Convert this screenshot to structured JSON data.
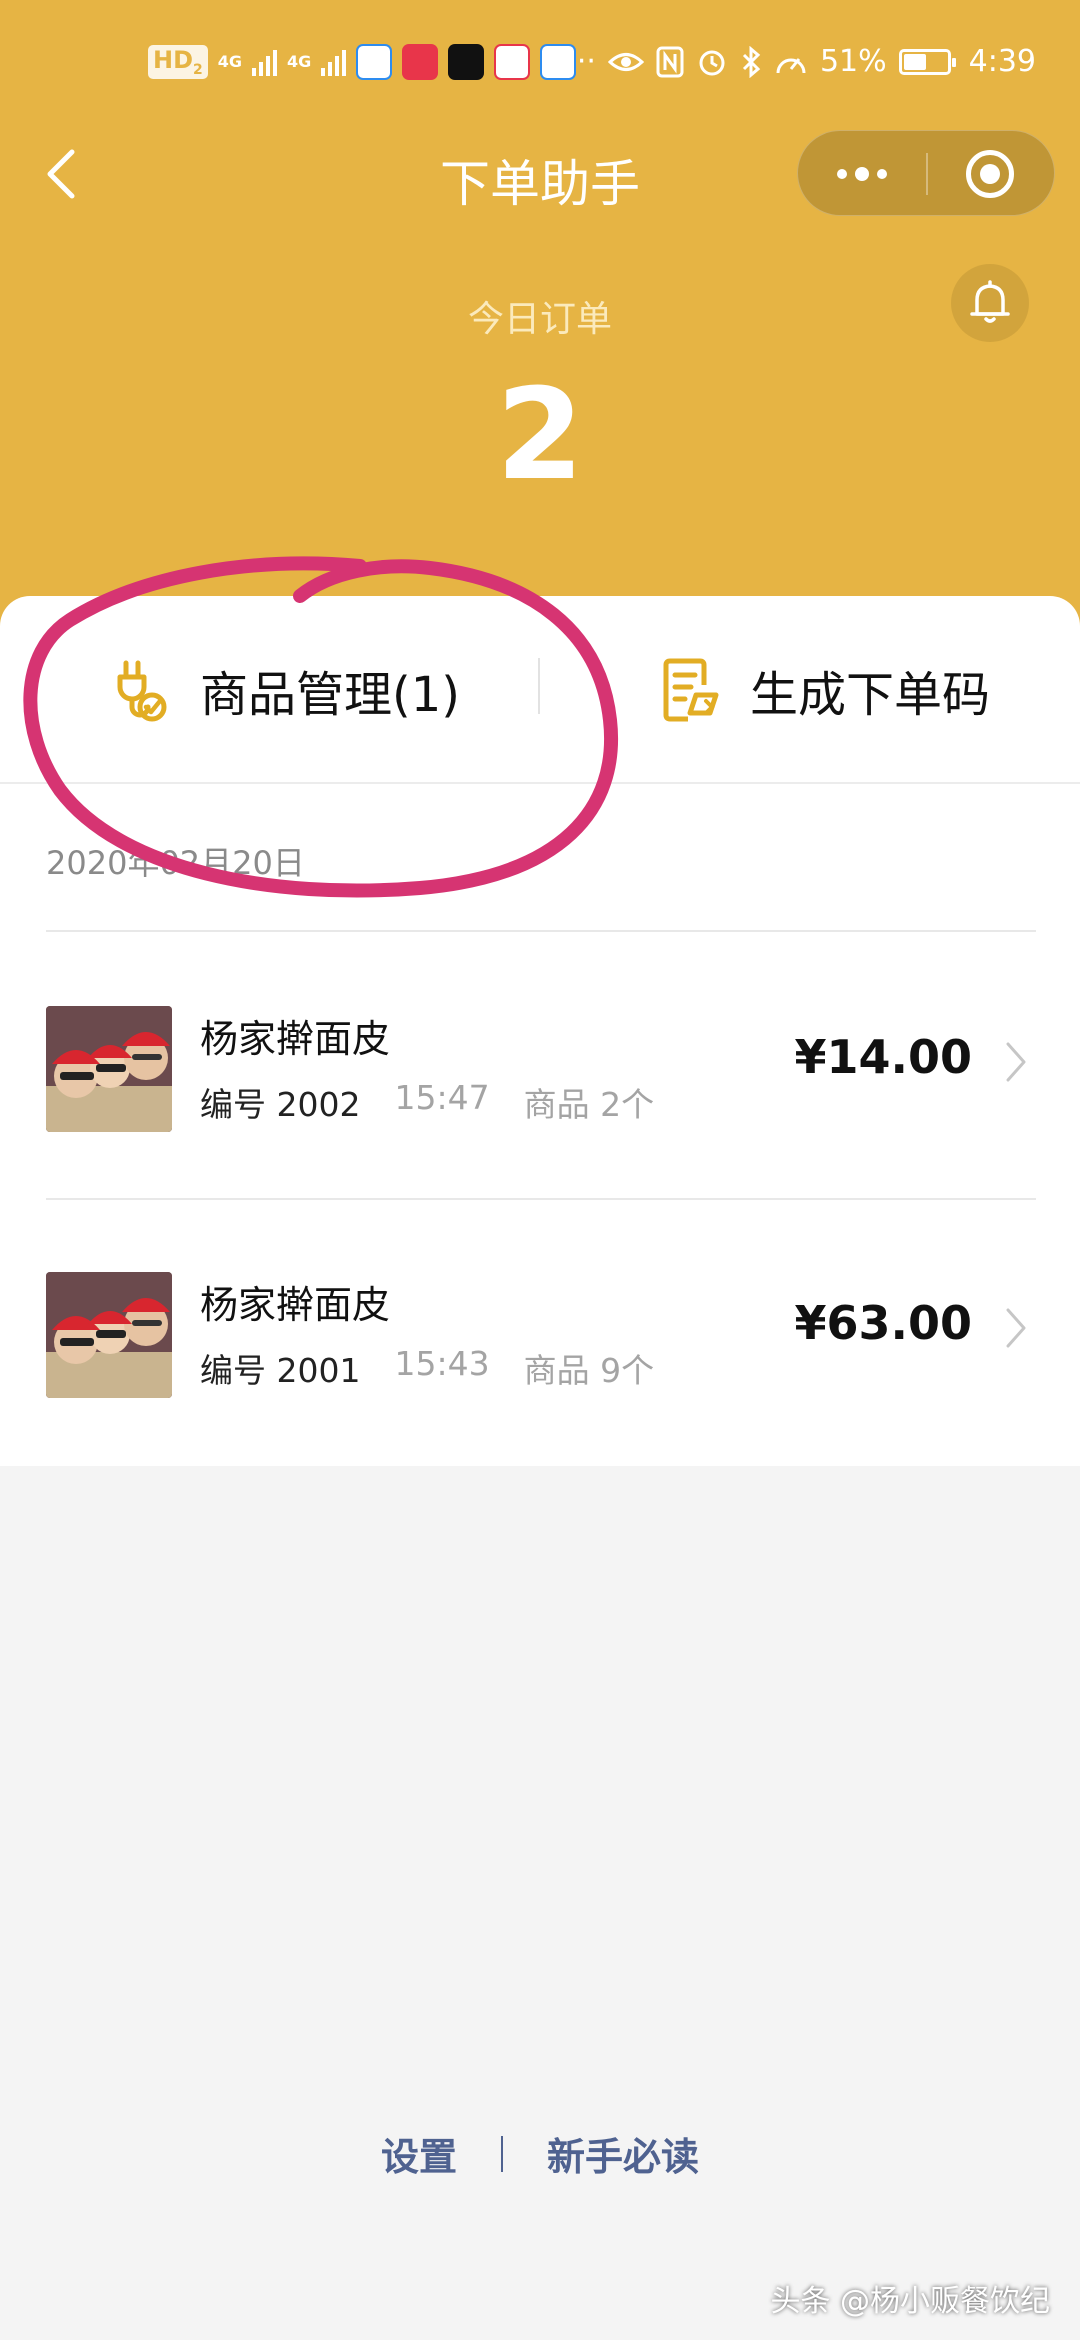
{
  "status_bar": {
    "hd": "HD",
    "hd_sub": "2",
    "net1": "4G",
    "net2": "4G",
    "more": "···",
    "battery_text": "51%",
    "battery_level": 0.51,
    "time": "4:39",
    "icons": [
      "eye-icon",
      "nfc-icon",
      "alarm-icon",
      "bluetooth-icon",
      "speed-icon"
    ]
  },
  "nav": {
    "title": "下单助手"
  },
  "summary": {
    "label": "今日订单",
    "count": "2"
  },
  "actions": {
    "goods_label": "商品管理(1)",
    "code_label": "生成下单码"
  },
  "orders": {
    "date": "2020年02月20日",
    "items": [
      {
        "shop": "杨家擀面皮",
        "number": "编号 2002",
        "time": "15:47",
        "count": "商品 2个",
        "price": "¥14.00"
      },
      {
        "shop": "杨家擀面皮",
        "number": "编号 2001",
        "time": "15:43",
        "count": "商品 9个",
        "price": "¥63.00"
      }
    ]
  },
  "footer": {
    "settings": "设置",
    "guide": "新手必读"
  },
  "watermark": "头条 @杨小贩餐饮纪",
  "colors": {
    "header_bg": "#e6b444",
    "accent_icon": "#e2ad24",
    "footer_link": "#4f6290",
    "annotation": "#d63472"
  }
}
